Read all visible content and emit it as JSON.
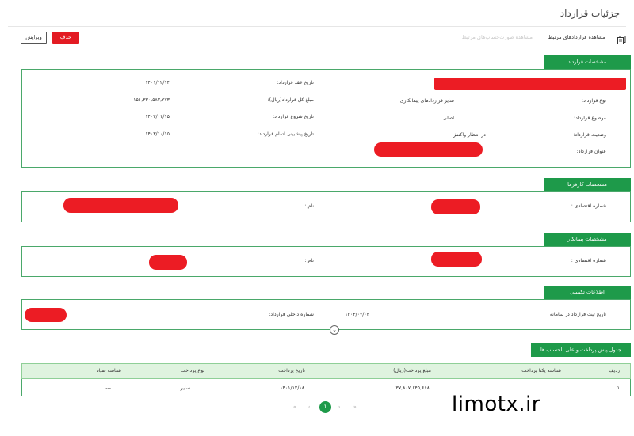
{
  "page": {
    "title": "جزئیات قرارداد"
  },
  "toolbar": {
    "delete_label": "حذف",
    "edit_label": "ویرایش",
    "related_contracts": "مشاهده قراردادهای مرتبط",
    "faded_link": "مشاهده صورت‌حساب‌های مرتبط"
  },
  "contract": {
    "header": "مشخصات قرارداد",
    "left": [
      {
        "label": "تاریخ عقد قرارداد:",
        "value": "۱۴۰۱/۱۲/۱۴"
      },
      {
        "label": "مبلغ کل قرارداد(ریال):",
        "value": "۱۵۱,۳۳۰,۵۸۲,۲۷۳"
      },
      {
        "label": "تاریخ شروع قرارداد:",
        "value": "۱۴۰۲/۰۱/۱۵"
      },
      {
        "label": "تاریخ پیشبینی اتمام قرارداد:",
        "value": "۱۴۰۳/۱۰/۱۵"
      }
    ],
    "right": [
      {
        "label": "نوع قرارداد:",
        "value": "سایر قراردادهای پیمانکاری"
      },
      {
        "label": "موضوع قرارداد:",
        "value": "اصلی"
      },
      {
        "label": "وضعیت قرارداد:",
        "value": "در انتظار واکنش"
      },
      {
        "label": "عنوان قرارداد:",
        "value": ""
      }
    ]
  },
  "employer": {
    "header": "مشخصات کارفرما",
    "name_label": "نام :",
    "eco_label": "شماره اقتصادی :"
  },
  "contractor": {
    "header": "مشخصات پیمانکار",
    "name_label": "نام :",
    "eco_label": "شماره اقتصادی :"
  },
  "extra": {
    "header": "اطلاعات تکمیلی",
    "reg_date_label": "تاریخ ثبت قرارداد در سامانه",
    "reg_date_value": "۱۴۰۳/۰۷/۰۴",
    "internal_label": "شماره داخلی قرارداد:"
  },
  "payments": {
    "header": "جدول پیش پرداخت و علی الحساب ها",
    "columns": [
      "ردیف",
      "شناسه یکتا پرداخت",
      "مبلغ پرداخت(ریال)",
      "تاریخ پرداخت",
      "نوع پرداخت",
      "شناسه صیاد"
    ],
    "rows": [
      [
        "۱",
        "",
        "۳۷,۸۰۷,۶۴۵,۶۶۸",
        "۱۴۰۱/۱۲/۱۸",
        "سایر",
        "---"
      ]
    ]
  },
  "pagination": {
    "first": "«",
    "prev": "‹",
    "current": "1",
    "next": "›",
    "last": "»"
  },
  "watermark": "limotx.ir",
  "colors": {
    "accent_green": "#1e9a4a",
    "danger_red": "#e31b23",
    "redaction": "#ec1c24"
  }
}
